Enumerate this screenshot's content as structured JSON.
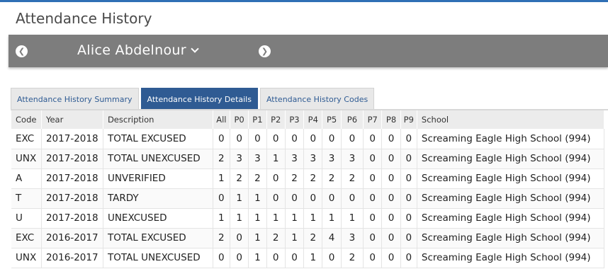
{
  "header": {
    "title": "Attendance History"
  },
  "student": {
    "name": "Alice Abdelnour"
  },
  "tabs": [
    {
      "label": "Attendance History Summary",
      "active": false
    },
    {
      "label": "Attendance History Details",
      "active": true
    },
    {
      "label": "Attendance History Codes",
      "active": false
    }
  ],
  "colors": {
    "accent": "#2f5b93",
    "bar": "#7d7d7d",
    "top_rule": "#2f6fb5"
  },
  "icons": {
    "prev": "arrow-left-circle-icon",
    "next": "arrow-right-circle-icon",
    "dropdown": "chevron-down-icon"
  },
  "table": {
    "columns": [
      "Code",
      "Year",
      "Description",
      "All",
      "P0",
      "P1",
      "P2",
      "P3",
      "P4",
      "P5",
      "P6",
      "P7",
      "P8",
      "P9",
      "School"
    ],
    "rows": [
      [
        "EXC",
        "2017-2018",
        "TOTAL EXCUSED",
        "0",
        "0",
        "0",
        "0",
        "0",
        "0",
        "0",
        "0",
        "0",
        "0",
        "0",
        "Screaming Eagle High School (994)"
      ],
      [
        "UNX",
        "2017-2018",
        "TOTAL UNEXCUSED",
        "2",
        "3",
        "3",
        "1",
        "3",
        "3",
        "3",
        "3",
        "0",
        "0",
        "0",
        "Screaming Eagle High School (994)"
      ],
      [
        "A",
        "2017-2018",
        "UNVERIFIED",
        "1",
        "2",
        "2",
        "0",
        "2",
        "2",
        "2",
        "2",
        "0",
        "0",
        "0",
        "Screaming Eagle High School (994)"
      ],
      [
        "T",
        "2017-2018",
        "TARDY",
        "0",
        "1",
        "1",
        "0",
        "0",
        "0",
        "0",
        "0",
        "0",
        "0",
        "0",
        "Screaming Eagle High School (994)"
      ],
      [
        "U",
        "2017-2018",
        "UNEXCUSED",
        "1",
        "1",
        "1",
        "1",
        "1",
        "1",
        "1",
        "1",
        "0",
        "0",
        "0",
        "Screaming Eagle High School (994)"
      ],
      [
        "EXC",
        "2016-2017",
        "TOTAL EXCUSED",
        "2",
        "0",
        "1",
        "2",
        "1",
        "2",
        "4",
        "3",
        "0",
        "0",
        "0",
        "Screaming Eagle High School (994)"
      ],
      [
        "UNX",
        "2016-2017",
        "TOTAL UNEXCUSED",
        "0",
        "0",
        "1",
        "0",
        "0",
        "1",
        "0",
        "2",
        "0",
        "0",
        "0",
        "Screaming Eagle High School (994)"
      ]
    ]
  }
}
